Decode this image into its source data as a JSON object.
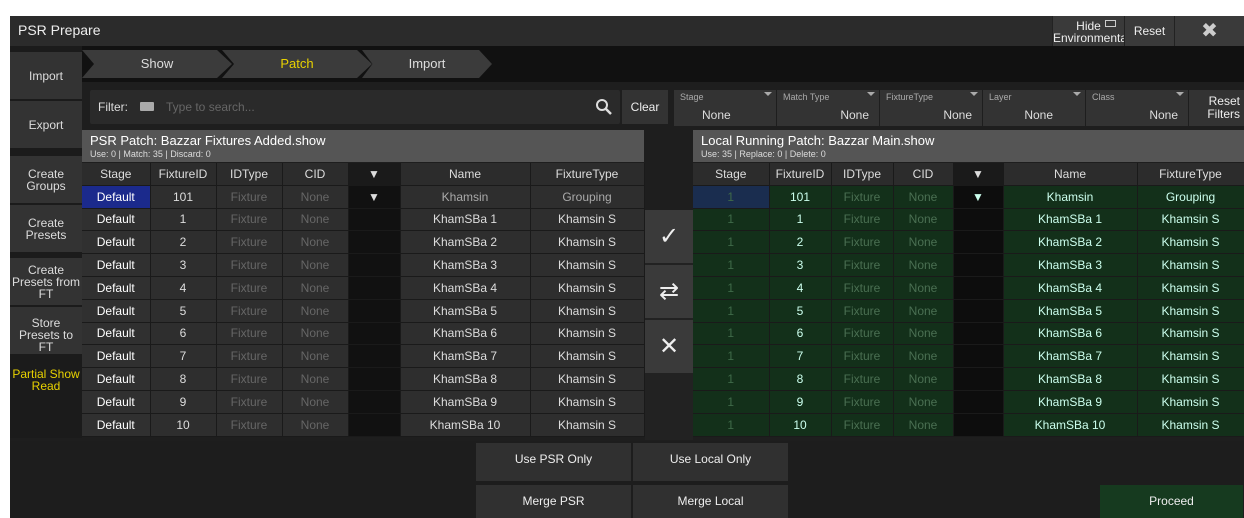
{
  "window": {
    "title": "PSR Prepare",
    "hide_env": "Hide Environmental",
    "reset": "Reset",
    "close_icon": "close-icon"
  },
  "sidebar": {
    "import": "Import",
    "export": "Export",
    "create_groups": "Create Groups",
    "create_presets": "Create Presets",
    "create_presets_ft": "Create Presets from FT",
    "store_presets": "Store Presets to FT",
    "partial_read": "Partial Show Read"
  },
  "tabs": [
    "Show",
    "Patch",
    "Import"
  ],
  "filter": {
    "label": "Filter:",
    "placeholder": "Type to search...",
    "clear": "Clear",
    "reset_filters": "Reset Filters"
  },
  "filters": [
    {
      "label": "Stage",
      "value": "None"
    },
    {
      "label": "Match Type",
      "value": "None"
    },
    {
      "label": "FixtureType",
      "value": "None"
    },
    {
      "label": "Layer",
      "value": "None"
    },
    {
      "label": "Class",
      "value": "None"
    }
  ],
  "left_panel": {
    "title": "PSR Patch: Bazzar Fixtures Added.show",
    "stats": "Use: 0 | Match: 35 | Discard: 0",
    "headers": [
      "Stage",
      "FixtureID",
      "IDType",
      "CID",
      "▼",
      "Name",
      "FixtureType"
    ],
    "rows": [
      [
        "Default",
        "101",
        "Fixture",
        "None",
        "▼",
        "Khamsin",
        "Grouping"
      ],
      [
        "Default",
        "1",
        "Fixture",
        "None",
        "",
        "KhamSBa 1",
        "Khamsin S"
      ],
      [
        "Default",
        "2",
        "Fixture",
        "None",
        "",
        "KhamSBa 2",
        "Khamsin S"
      ],
      [
        "Default",
        "3",
        "Fixture",
        "None",
        "",
        "KhamSBa 3",
        "Khamsin S"
      ],
      [
        "Default",
        "4",
        "Fixture",
        "None",
        "",
        "KhamSBa 4",
        "Khamsin S"
      ],
      [
        "Default",
        "5",
        "Fixture",
        "None",
        "",
        "KhamSBa 5",
        "Khamsin S"
      ],
      [
        "Default",
        "6",
        "Fixture",
        "None",
        "",
        "KhamSBa 6",
        "Khamsin S"
      ],
      [
        "Default",
        "7",
        "Fixture",
        "None",
        "",
        "KhamSBa 7",
        "Khamsin S"
      ],
      [
        "Default",
        "8",
        "Fixture",
        "None",
        "",
        "KhamSBa 8",
        "Khamsin S"
      ],
      [
        "Default",
        "9",
        "Fixture",
        "None",
        "",
        "KhamSBa 9",
        "Khamsin S"
      ],
      [
        "Default",
        "10",
        "Fixture",
        "None",
        "",
        "KhamSBa 10",
        "Khamsin S"
      ]
    ]
  },
  "right_panel": {
    "title": "Local Running Patch: Bazzar Main.show",
    "stats": "Use: 35 | Replace: 0 | Delete: 0",
    "headers": [
      "Stage",
      "FixtureID",
      "IDType",
      "CID",
      "▼",
      "Name",
      "FixtureType"
    ],
    "rows": [
      [
        "1",
        "101",
        "Fixture",
        "None",
        "▼",
        "Khamsin",
        "Grouping"
      ],
      [
        "1",
        "1",
        "Fixture",
        "None",
        "",
        "KhamSBa 1",
        "Khamsin S"
      ],
      [
        "1",
        "2",
        "Fixture",
        "None",
        "",
        "KhamSBa 2",
        "Khamsin S"
      ],
      [
        "1",
        "3",
        "Fixture",
        "None",
        "",
        "KhamSBa 3",
        "Khamsin S"
      ],
      [
        "1",
        "4",
        "Fixture",
        "None",
        "",
        "KhamSBa 4",
        "Khamsin S"
      ],
      [
        "1",
        "5",
        "Fixture",
        "None",
        "",
        "KhamSBa 5",
        "Khamsin S"
      ],
      [
        "1",
        "6",
        "Fixture",
        "None",
        "",
        "KhamSBa 6",
        "Khamsin S"
      ],
      [
        "1",
        "7",
        "Fixture",
        "None",
        "",
        "KhamSBa 7",
        "Khamsin S"
      ],
      [
        "1",
        "8",
        "Fixture",
        "None",
        "",
        "KhamSBa 8",
        "Khamsin S"
      ],
      [
        "1",
        "9",
        "Fixture",
        "None",
        "",
        "KhamSBa 9",
        "Khamsin S"
      ],
      [
        "1",
        "10",
        "Fixture",
        "None",
        "",
        "KhamSBa 10",
        "Khamsin S"
      ]
    ]
  },
  "middle_icons": [
    "check-icon",
    "swap-icon",
    "cross-icon"
  ],
  "bottom": {
    "use_psr": "Use PSR Only",
    "use_local": "Use Local Only",
    "merge_psr": "Merge PSR",
    "merge_local": "Merge Local",
    "proceed": "Proceed"
  },
  "colors": {
    "selected": "#1b2a8c",
    "local_green": "#13301a",
    "partial_read": "#e8d200",
    "active_tab": "#e8d200"
  }
}
